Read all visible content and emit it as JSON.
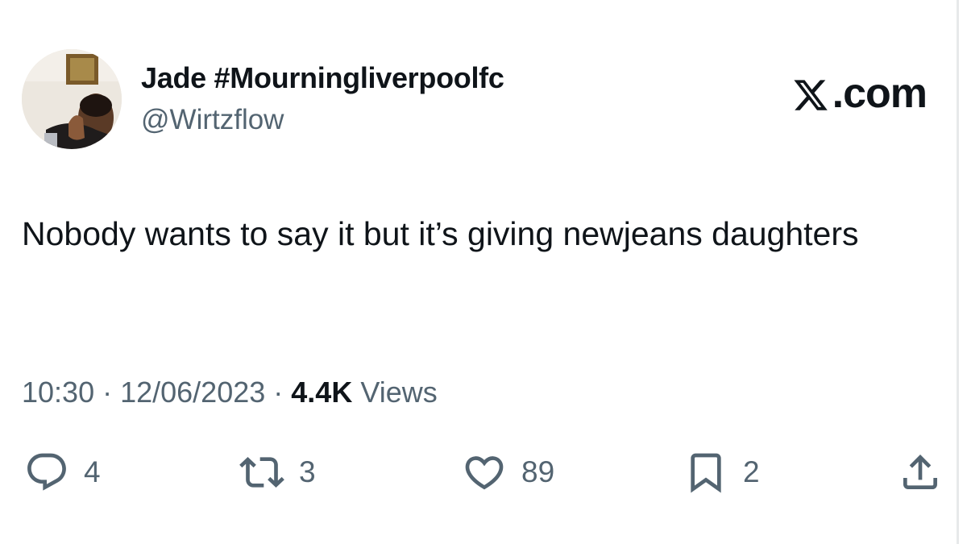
{
  "author": {
    "display_name": "Jade #Mourningliverpoolfc",
    "handle": "@Wirtzflow"
  },
  "brand": {
    "label": ".com"
  },
  "tweet": {
    "text": "Nobody wants to say it but it’s giving newjeans daughters"
  },
  "meta": {
    "time": "10:30",
    "separator": " · ",
    "date": "12/06/2023",
    "views_count": "4.4K",
    "views_label": " Views"
  },
  "actions": {
    "replies": "4",
    "retweets": "3",
    "likes": "89",
    "bookmarks": "2"
  },
  "icons": {
    "reply": "reply-icon",
    "retweet": "retweet-icon",
    "like": "heart-icon",
    "bookmark": "bookmark-icon",
    "share": "share-icon",
    "brand": "x-logo-icon"
  },
  "colors": {
    "text": "#0f1419",
    "secondary": "#536471",
    "background": "#ffffff"
  }
}
